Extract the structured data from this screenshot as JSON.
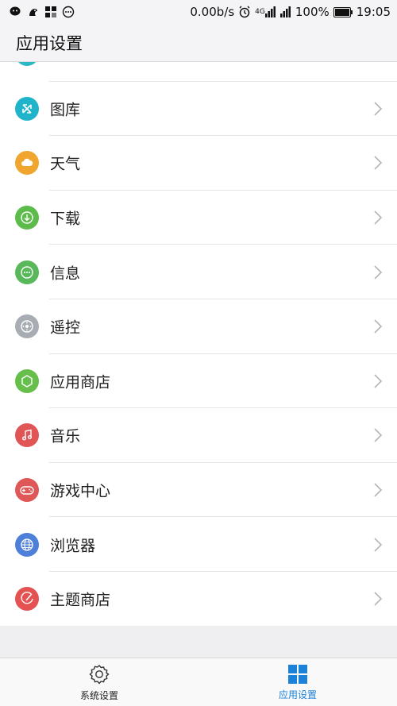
{
  "status_bar": {
    "speed": "0.00b/s",
    "network": "4G",
    "battery": "100%",
    "time": "19:05"
  },
  "header": {
    "title": "应用设置"
  },
  "items": [
    {
      "label": "图库",
      "icon": "gallery-icon",
      "color": "#1fb4c9"
    },
    {
      "label": "天气",
      "icon": "weather-icon",
      "color": "#f0a62e"
    },
    {
      "label": "下载",
      "icon": "download-icon",
      "color": "#5dbb4b"
    },
    {
      "label": "信息",
      "icon": "message-icon",
      "color": "#58b85a"
    },
    {
      "label": "遥控",
      "icon": "remote-control-icon",
      "color": "#a8adb3"
    },
    {
      "label": "应用商店",
      "icon": "app-store-icon",
      "color": "#67bf4b"
    },
    {
      "label": "音乐",
      "icon": "music-icon",
      "color": "#e05555"
    },
    {
      "label": "游戏中心",
      "icon": "game-center-icon",
      "color": "#e05757"
    },
    {
      "label": "浏览器",
      "icon": "browser-icon",
      "color": "#4e7fd9"
    },
    {
      "label": "主题商店",
      "icon": "theme-store-icon",
      "color": "#e45252"
    }
  ],
  "tabs": [
    {
      "label": "系统设置",
      "icon": "gear-icon",
      "active": false
    },
    {
      "label": "应用设置",
      "icon": "apps-grid-icon",
      "active": true,
      "color": "#1a82d8"
    }
  ]
}
